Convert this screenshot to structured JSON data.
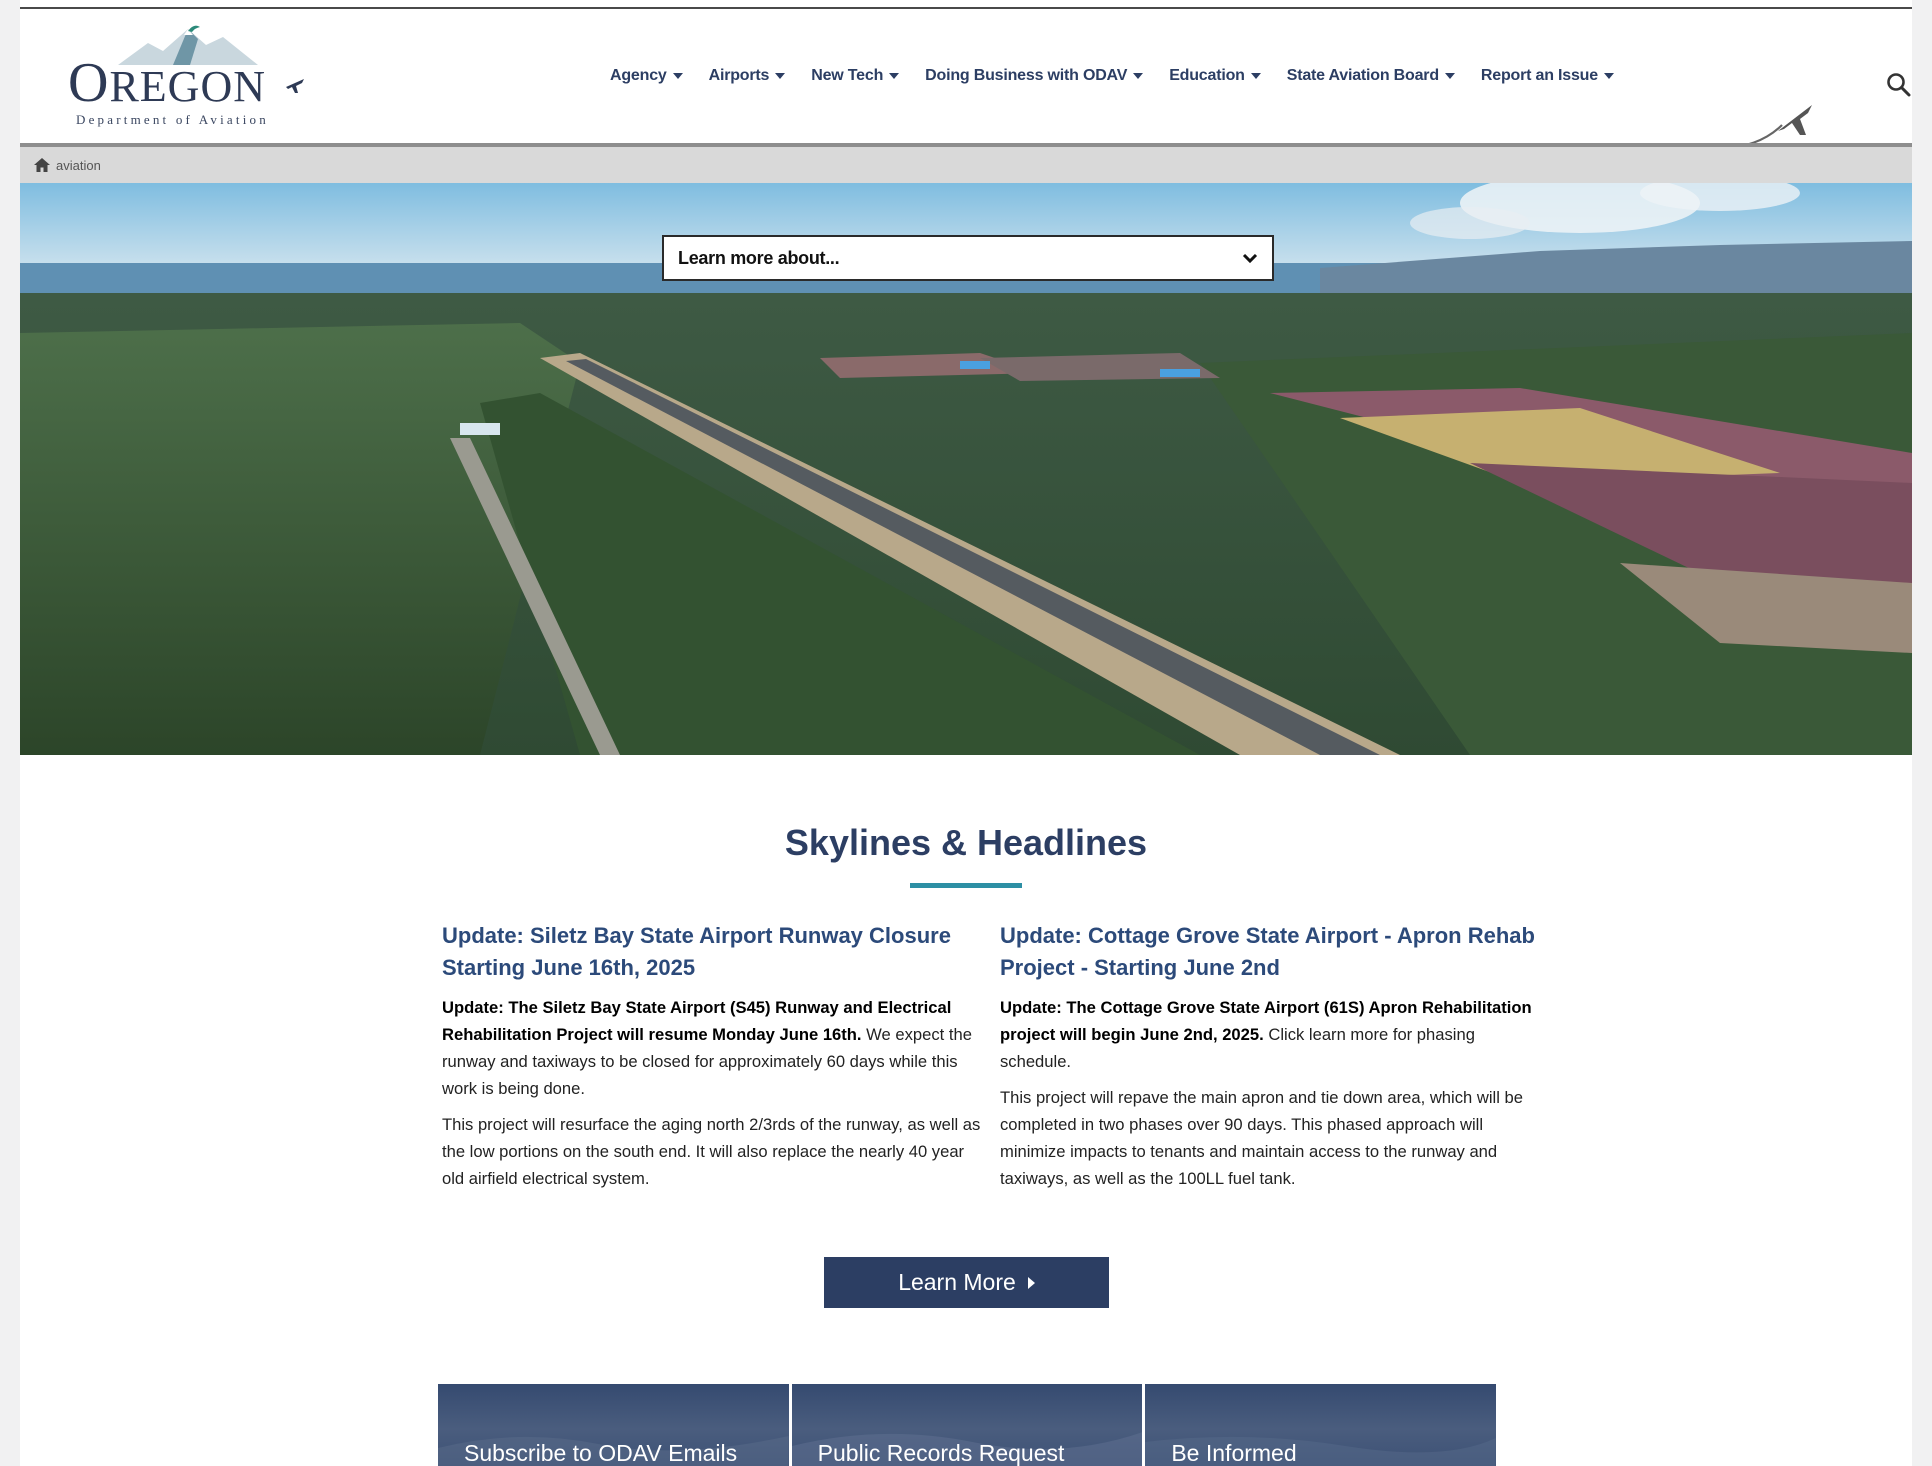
{
  "site": {
    "logo_word_big": "O",
    "logo_word_rest": "REGON",
    "logo_subtitle": "Department of Aviation"
  },
  "nav": {
    "items": [
      {
        "label": "Agency"
      },
      {
        "label": "Airports"
      },
      {
        "label": "New Tech"
      },
      {
        "label": "Doing Business with ODAV"
      },
      {
        "label": "Education"
      },
      {
        "label": "State Aviation Board"
      },
      {
        "label": "Report an Issue"
      }
    ]
  },
  "breadcrumb": {
    "current": "aviation"
  },
  "hero": {
    "select_value": "Learn more about..."
  },
  "headlines": {
    "title": "Skylines & Headlines",
    "articles": [
      {
        "title": "Update: Siletz Bay State Airport Runway Closure Starting June 16th, 2025",
        "lead_bold": "Update: The Siletz Bay State Airport (S45) Runway and Electrical Rehabilitation Project will resume Monday June 16th.",
        "lead_rest": " We expect the runway and taxiways to be closed for approximately 60 days while this work is being done.",
        "body": "This project will resurface the aging north 2/3rds of the runway, as well as the low portions on the south end. It will also replace the nearly 40 year old airfield electrical system."
      },
      {
        "title": "Update: Cottage Grove State Airport - Apron Rehab Project - Starting June 2nd",
        "lead_bold": "Update: The Cottage Grove State Airport (61S) Apron Rehabilitation project will begin June 2nd, 2025.",
        "lead_rest": " Click learn more for phasing schedule.",
        "body": "This project will repave the main apron and tie down area, which will be completed in two phases over 90 days. This phased approach will minimize impacts to tenants and maintain access to the runway and taxiways, as well as the 100LL fuel tank."
      }
    ],
    "learn_more_label": "Learn More"
  },
  "cards": [
    {
      "label": "Subscribe to ODAV Emails"
    },
    {
      "label": "Public Records Request"
    },
    {
      "label": "Be Informed"
    }
  ],
  "colors": {
    "brand_navy": "#2c3e63",
    "accent_teal": "#2d8fa4",
    "breadcrumb_bg": "#d9d9d9"
  },
  "icons": [
    "mountain-logo-icon",
    "plane-icon",
    "search-icon",
    "home-icon",
    "chevron-down-icon",
    "caret-right-icon"
  ]
}
